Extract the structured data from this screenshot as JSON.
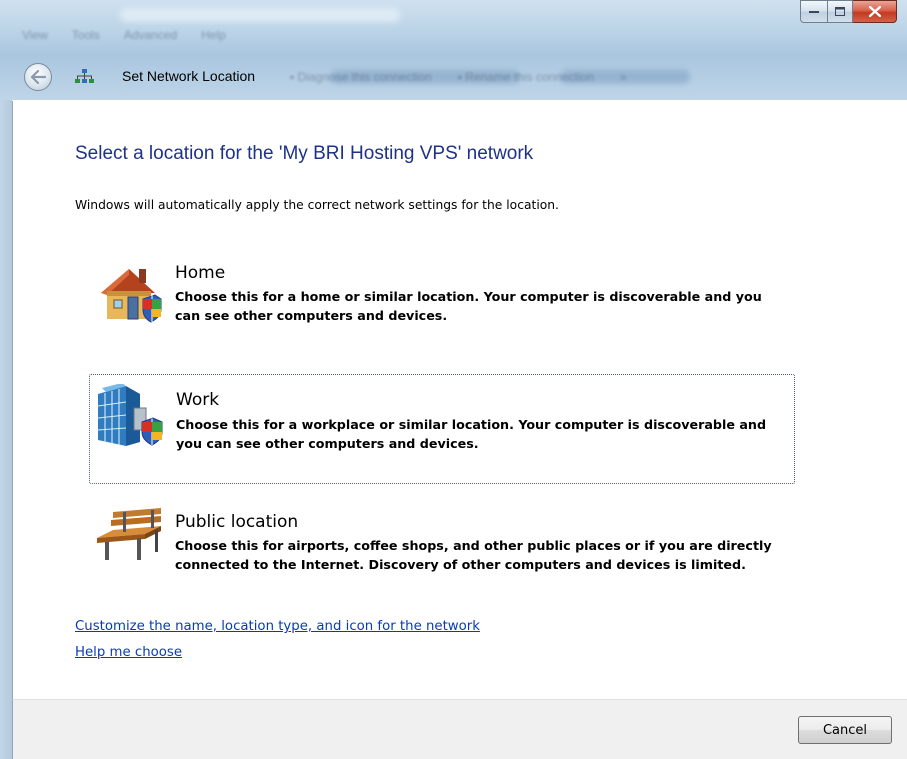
{
  "window": {
    "nav_title": "Set Network Location",
    "colors": {
      "heading": "#1e3287",
      "link": "#0a3bb5",
      "glass": "#bcd4e8"
    }
  },
  "content": {
    "heading": "Select a location for the 'My BRI Hosting VPS' network",
    "description": "Windows will automatically apply the correct network settings for the location.",
    "options": [
      {
        "title": "Home",
        "icon": "house-shield-icon",
        "description": "Choose this for a home or similar location. Your computer is discoverable and you can see other computers and devices."
      },
      {
        "title": "Work",
        "icon": "office-building-shield-icon",
        "description": "Choose this for a workplace or similar location. Your computer is discoverable and you can see other computers and devices."
      },
      {
        "title": "Public location",
        "icon": "park-bench-icon",
        "description": "Choose this for airports, coffee shops, and other public places or if you are directly connected to the Internet. Discovery of other computers and devices is limited."
      }
    ],
    "links": {
      "customize": "Customize the name, location type, and icon for the network",
      "help": "Help me choose"
    }
  },
  "footer": {
    "cancel_label": "Cancel"
  }
}
